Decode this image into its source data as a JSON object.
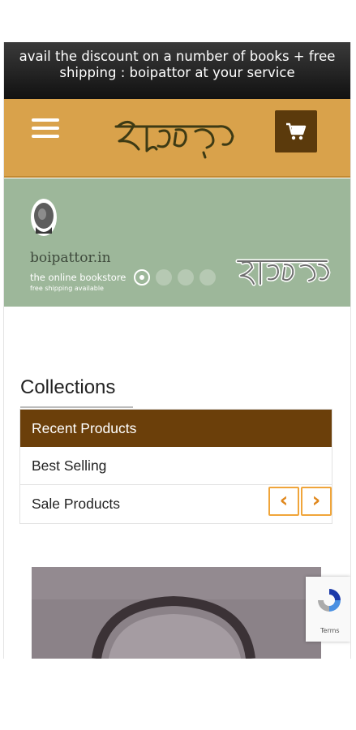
{
  "announcement": {
    "line1": "avail the discount on a number of books + free",
    "line2": "shipping : boipattor at your service"
  },
  "header": {
    "menu_icon": "hamburger-icon",
    "cart_icon": "cart-icon",
    "brand_color": "#d9a24b"
  },
  "banner": {
    "site_name": "boipattor.in",
    "tagline": "the online bookstore",
    "shipping_note": "free shipping available",
    "slides": 4,
    "active_slide": 1,
    "background": "#9db79a"
  },
  "collections": {
    "title": "Collections",
    "tabs": [
      {
        "label": "Recent Products",
        "active": true
      },
      {
        "label": "Best Selling",
        "active": false
      },
      {
        "label": "Sale Products",
        "active": false
      }
    ],
    "prev_icon": "chevron-left-icon",
    "next_icon": "chevron-right-icon",
    "prev_label": "‹",
    "next_label": "›"
  },
  "recaptcha": {
    "terms_text": "Terms"
  }
}
